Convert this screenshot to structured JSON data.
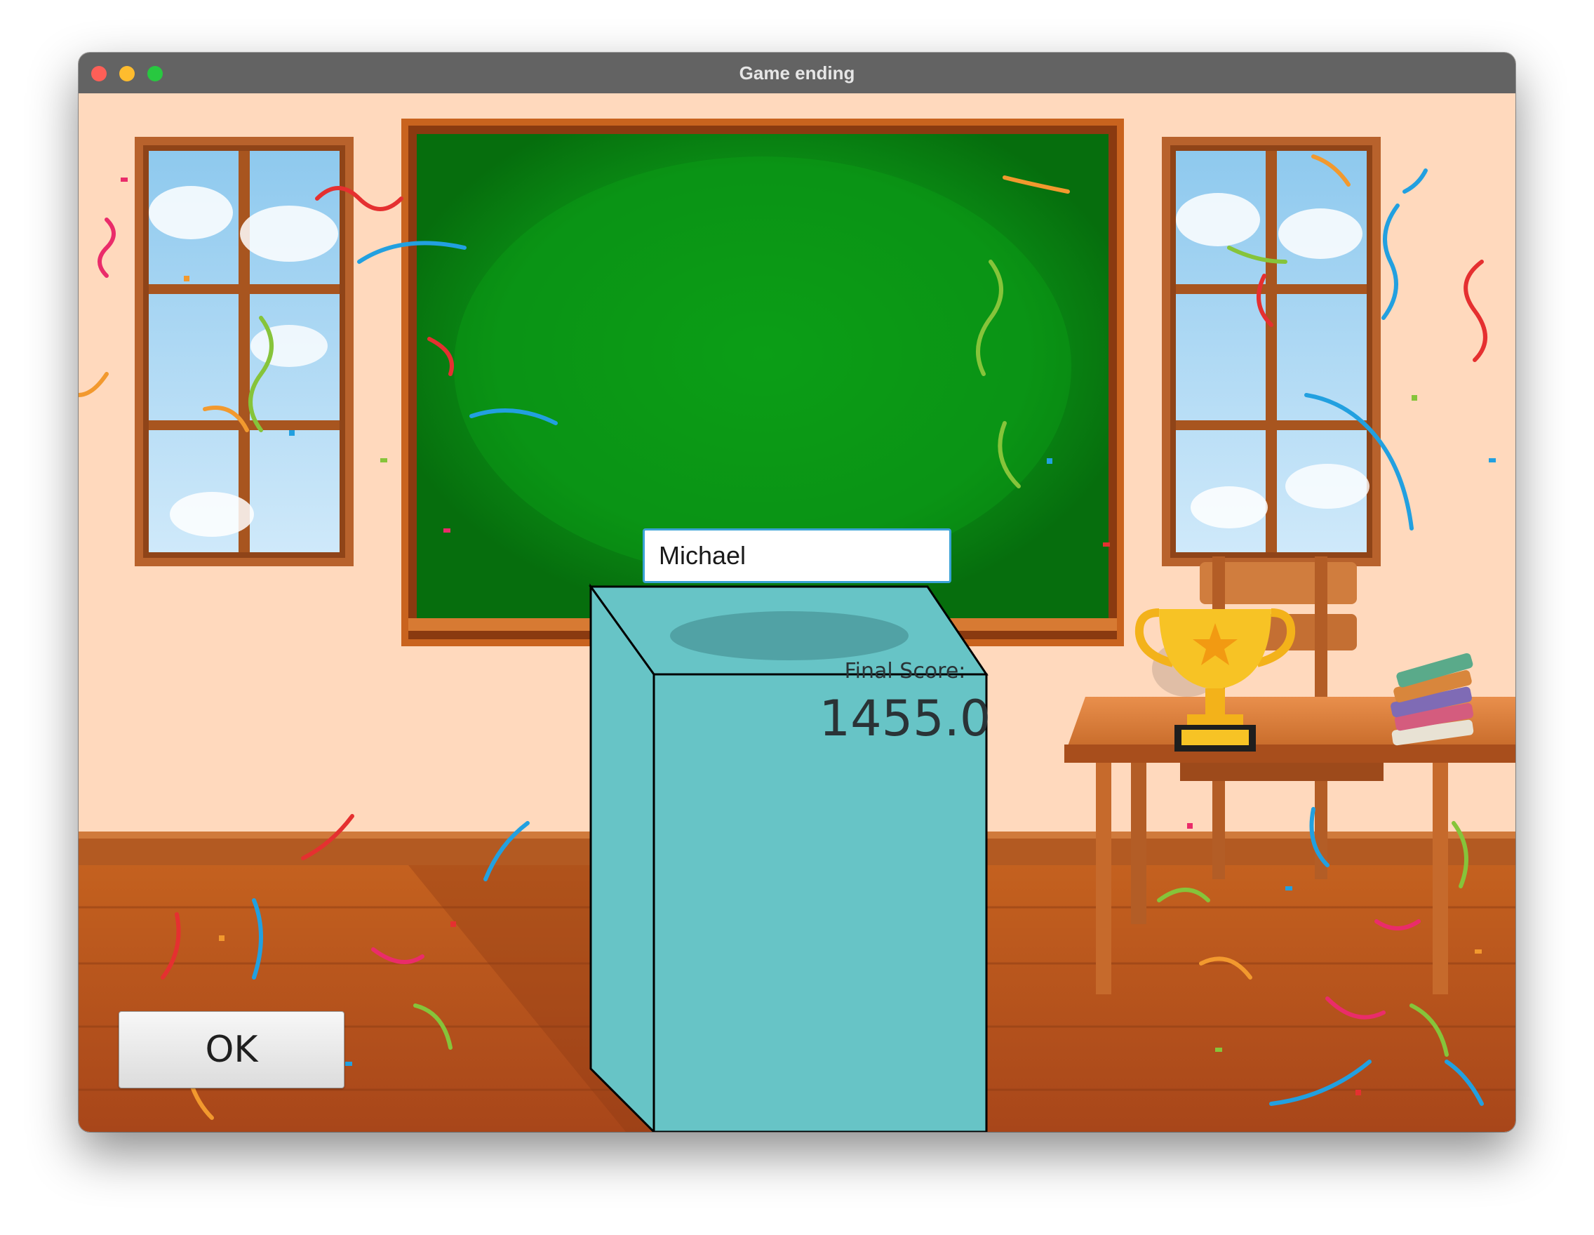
{
  "window": {
    "title": "Game ending"
  },
  "form": {
    "player_name_value": "Michael"
  },
  "score": {
    "label": "Final Score:",
    "value": "1455.0"
  },
  "buttons": {
    "ok_label": "OK"
  },
  "colors": {
    "wall": "#ffd9bd",
    "chalkboard": "#0a7a12",
    "pedestal": "#67c4c6",
    "floor": "#b8531d",
    "input_border": "#3aa2d6"
  },
  "icons": [
    "trophy-icon",
    "books-icon",
    "window-close-icon",
    "window-minimize-icon",
    "window-maximize-icon"
  ]
}
